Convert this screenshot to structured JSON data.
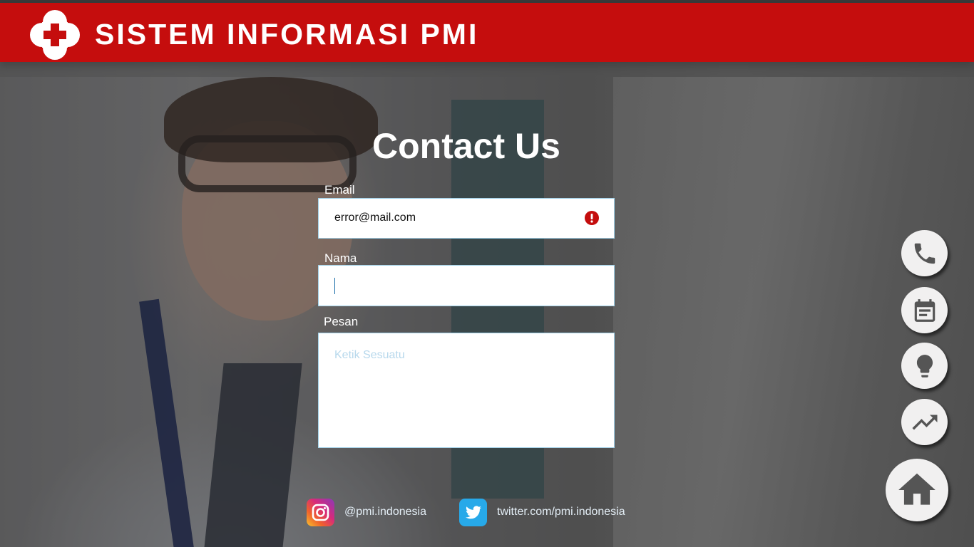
{
  "header": {
    "title": "SISTEM INFORMASI PMI",
    "logo_icon": "red-cross-icon",
    "color": "#c50d0d"
  },
  "form": {
    "heading": "Contact Us",
    "email": {
      "label": "Email",
      "value": "error@mail.com",
      "status": "error",
      "status_icon": "error-icon",
      "status_color": "#c40d0d"
    },
    "nama": {
      "label": "Nama",
      "value": ""
    },
    "pesan": {
      "label": "Pesan",
      "placeholder": "Ketik Sesuatu"
    }
  },
  "social": {
    "instagram": {
      "icon": "instagram-icon",
      "text": "@pmi.indonesia"
    },
    "twitter": {
      "icon": "twitter-icon",
      "text": "twitter.com/pmi.indonesia"
    }
  },
  "fab": [
    {
      "name": "phone-button",
      "icon": "phone-icon"
    },
    {
      "name": "calendar-button",
      "icon": "calendar-icon"
    },
    {
      "name": "idea-button",
      "icon": "lightbulb-icon"
    },
    {
      "name": "trend-button",
      "icon": "trending-up-icon"
    },
    {
      "name": "home-button",
      "icon": "home-icon"
    }
  ]
}
